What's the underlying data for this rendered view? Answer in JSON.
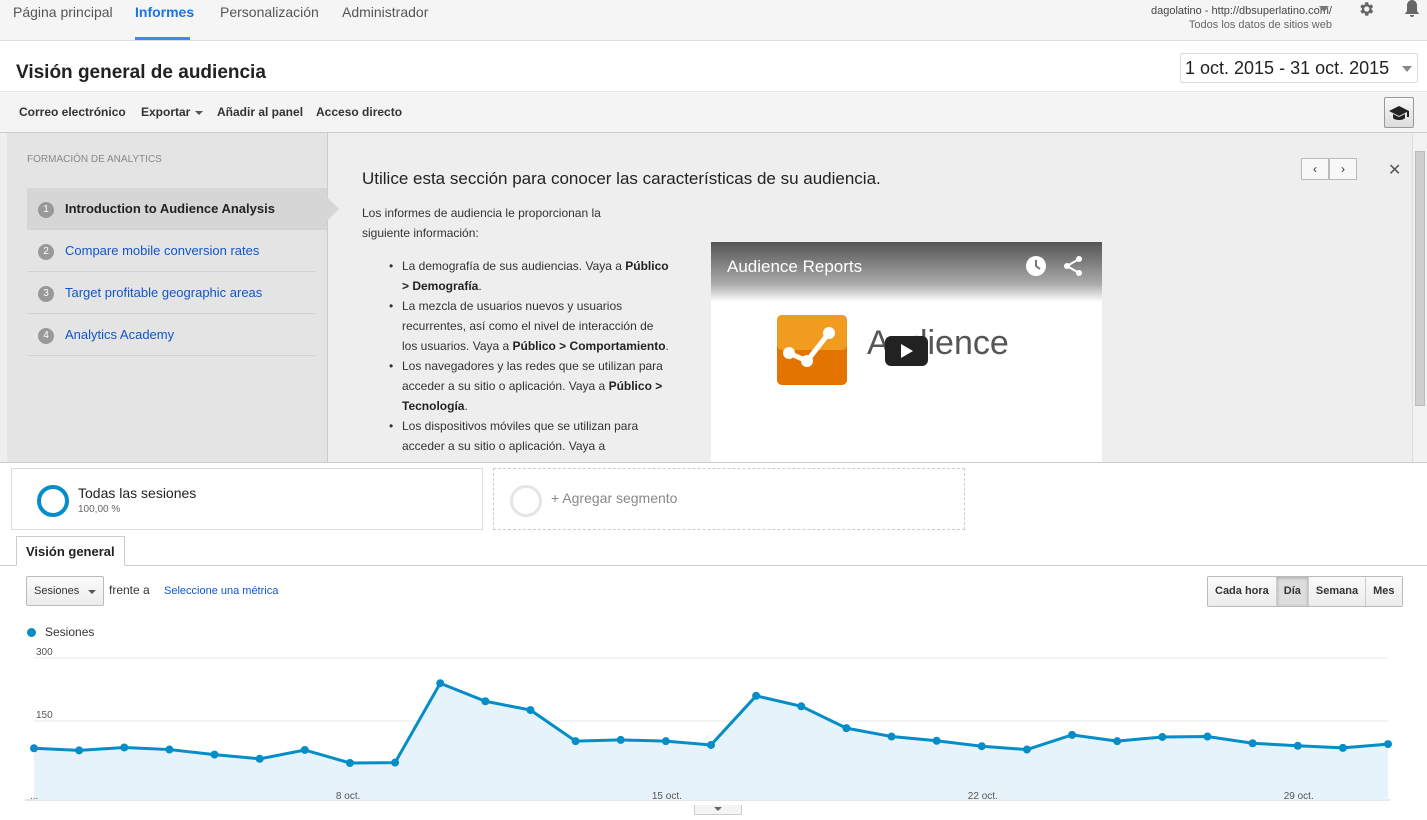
{
  "nav": {
    "tabs": [
      "Página principal",
      "Informes",
      "Personalización",
      "Administrador"
    ],
    "account_line1": "dagolatino - http://dbsuperlatino.com/",
    "account_line2": "Todos los datos de sitios web"
  },
  "header": {
    "title": "Visión general de audiencia",
    "date_range": "1 oct. 2015 - 31 oct. 2015"
  },
  "toolbar": {
    "email": "Correo electrónico",
    "export": "Exportar",
    "add_to_dashboard": "Añadir al panel",
    "shortcut": "Acceso directo"
  },
  "training": {
    "heading": "FORMACIÓN DE ANALYTICS",
    "steps": [
      {
        "num": "1",
        "label": "Introduction to Audience Analysis"
      },
      {
        "num": "2",
        "label": "Compare mobile conversion rates"
      },
      {
        "num": "3",
        "label": "Target profitable geographic areas"
      },
      {
        "num": "4",
        "label": "Analytics Academy"
      }
    ],
    "title": "Utilice esta sección para conocer las características de su audiencia.",
    "intro": "Los informes de audiencia le proporcionan la siguiente información:",
    "bullets": [
      {
        "text": "La demografía de sus audiencias. Vaya a ",
        "bold": "Público > Demografía",
        "end": "."
      },
      {
        "text": "La mezcla de usuarios nuevos y usuarios recurrentes, así como el nivel de interacción de los usuarios. Vaya a ",
        "bold": "Público > Comportamiento",
        "end": "."
      },
      {
        "text": "Los navegadores y las redes que se utilizan para acceder a su sitio o aplicación. Vaya a ",
        "bold": "Público > Tecnología",
        "end": "."
      },
      {
        "text": "Los dispositivos móviles que se utilizan para acceder a su sitio o aplicación. Vaya a",
        "bold": "",
        "end": ""
      }
    ],
    "prev": "‹",
    "next": "›",
    "close": "✕",
    "video_title": "Audience Reports",
    "video_word": "Audience"
  },
  "segments": {
    "all_title": "Todas las sesiones",
    "all_pct": "100,00 %",
    "add_label": "+ Agregar segmento"
  },
  "tabs": {
    "overview": "Visión general"
  },
  "metric": {
    "selected": "Sesiones",
    "vs": "frente a",
    "select_metric": "Seleccione una métrica"
  },
  "granularity": {
    "options": [
      "Cada hora",
      "Día",
      "Semana",
      "Mes"
    ],
    "selected": "Día"
  },
  "colors": {
    "series": "#058dc7",
    "accent": "#4285f4"
  },
  "chart_data": {
    "type": "area",
    "series": [
      {
        "name": "Sesiones",
        "values": [
          85,
          80,
          87,
          82,
          70,
          60,
          81,
          50,
          51,
          240,
          197,
          176,
          102,
          105,
          102,
          93,
          210,
          185,
          133,
          113,
          103,
          90,
          82,
          117,
          102,
          112,
          113,
          97,
          91,
          86,
          95
        ]
      }
    ],
    "x": [
      "1 oct.",
      "2 oct.",
      "3 oct.",
      "4 oct.",
      "5 oct.",
      "6 oct.",
      "7 oct.",
      "8 oct.",
      "9 oct.",
      "10 oct.",
      "11 oct.",
      "12 oct.",
      "13 oct.",
      "14 oct.",
      "15 oct.",
      "16 oct.",
      "17 oct.",
      "18 oct.",
      "19 oct.",
      "20 oct.",
      "21 oct.",
      "22 oct.",
      "23 oct.",
      "24 oct.",
      "25 oct.",
      "26 oct.",
      "27 oct.",
      "28 oct.",
      "29 oct.",
      "30 oct.",
      "31 oct."
    ],
    "x_tick_labels": [
      "...",
      "8 oct.",
      "15 oct.",
      "22 oct.",
      "29 oct."
    ],
    "y_tick_labels": [
      "300",
      "150"
    ],
    "ylim": [
      0,
      300
    ],
    "grid": true,
    "legend": "top-left"
  }
}
